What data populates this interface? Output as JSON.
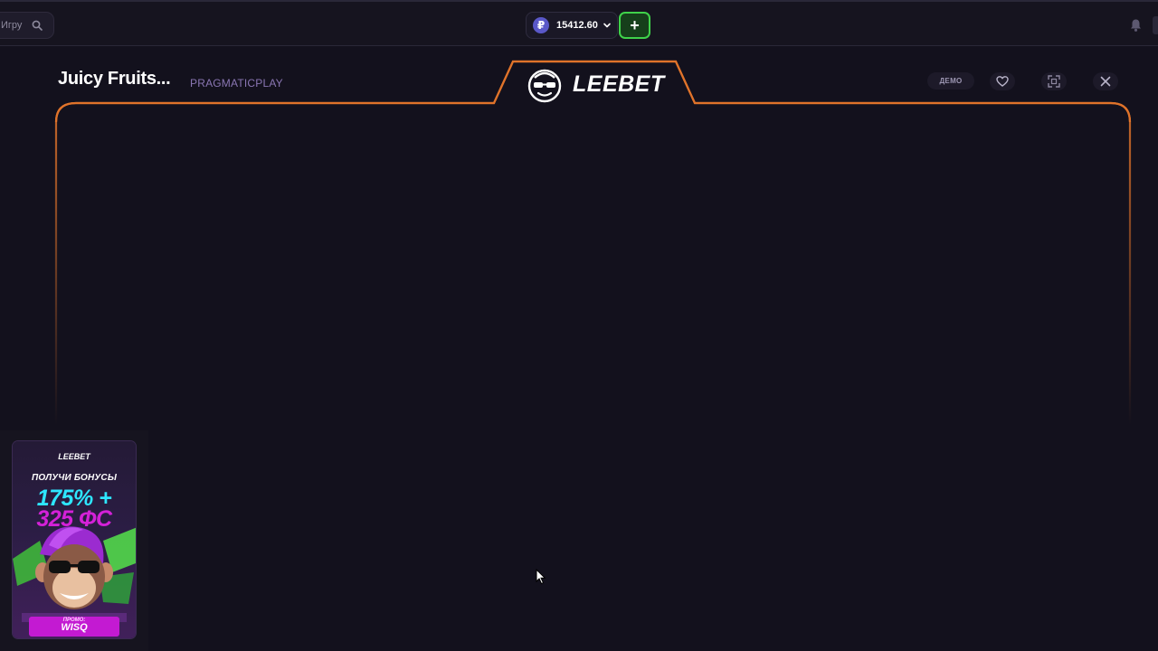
{
  "header": {
    "search": {
      "placeholder": "Игру",
      "icon": "search-icon"
    },
    "balance": {
      "currency_symbol": "₽",
      "amount": "15412.60",
      "icon": "ruble-coin-icon"
    },
    "deposit_button": {
      "label": "+",
      "color": "#3fd24a"
    },
    "notifications_icon": "bell-icon"
  },
  "game": {
    "title": "Juicy Fruits...",
    "provider": "PRAGMATICPLAY",
    "brand": "LEEBET",
    "frame_color": "#e0732a",
    "controls": {
      "demo_label": "ДЕМО",
      "favorite_icon": "heart-icon",
      "fullscreen_icon": "fullscreen-icon",
      "close_icon": "close-icon"
    }
  },
  "promo_banner": {
    "brand": "LEEBET",
    "subtitle": "ПОЛУЧИ БОНУСЫ",
    "percent_bonus": "175% +",
    "freespins": "325 ФС",
    "promo_label": "ПРОМО:",
    "promo_code": "WISQ",
    "colors": {
      "percent": "#2ee6ff",
      "freespins": "#d421d8",
      "code_bg": "#c31ad2"
    }
  }
}
